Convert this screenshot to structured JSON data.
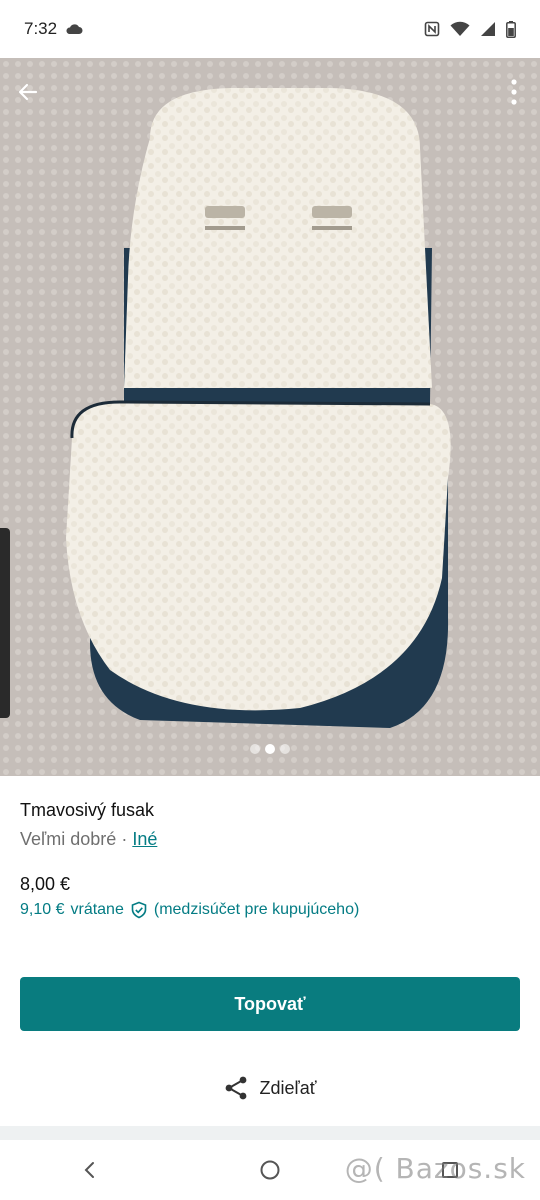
{
  "status_bar": {
    "time": "7:32"
  },
  "gallery": {
    "image_count": 3,
    "active_index": 1
  },
  "item": {
    "title": "Tmavosivý fusak",
    "condition": "Veľmi dobré",
    "separator": " · ",
    "category": "Iné",
    "price": "8,00 €",
    "price_with_fee": "9,10 €",
    "fee_text": "vrátane",
    "fee_note": "(medzisúčet pre kupujúceho)"
  },
  "actions": {
    "primary_label": "Topovať",
    "share_label": "Zdieľať"
  },
  "watermark": "@( Bazos.sk",
  "colors": {
    "accent": "#097c7f",
    "link": "#047c84"
  }
}
